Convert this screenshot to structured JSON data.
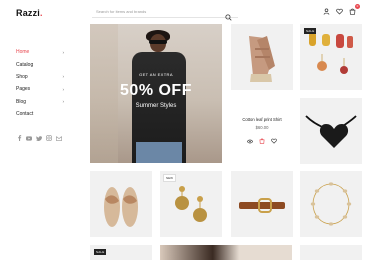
{
  "brand": {
    "name": "Razzi",
    "accent": "#e8474f"
  },
  "search": {
    "placeholder": "Search for items and brands",
    "icon": "search-icon"
  },
  "header": {
    "icons": [
      "user-icon",
      "heart-icon",
      "cart-icon"
    ],
    "cart_count": "0"
  },
  "sidebar": {
    "items": [
      {
        "label": "Home",
        "active": true,
        "chevron": "›"
      },
      {
        "label": "Catalog",
        "active": false,
        "chevron": ""
      },
      {
        "label": "Shop",
        "active": false,
        "chevron": "›"
      },
      {
        "label": "Pages",
        "active": false,
        "chevron": "›"
      },
      {
        "label": "Blog",
        "active": false,
        "chevron": "›"
      },
      {
        "label": "Contact",
        "active": false,
        "chevron": ""
      }
    ]
  },
  "socials": [
    "facebook-icon",
    "youtube-icon",
    "twitter-icon",
    "instagram-icon",
    "mail-icon"
  ],
  "hero": {
    "kicker": "GET AN EXTRA",
    "headline": "50% OFF",
    "subtitle": "Summer Styles"
  },
  "badges": {
    "sale": "SALE",
    "new": "NEW"
  },
  "featured_product": {
    "name": "Cotton leaf print Shirt",
    "price": "$60.00"
  }
}
